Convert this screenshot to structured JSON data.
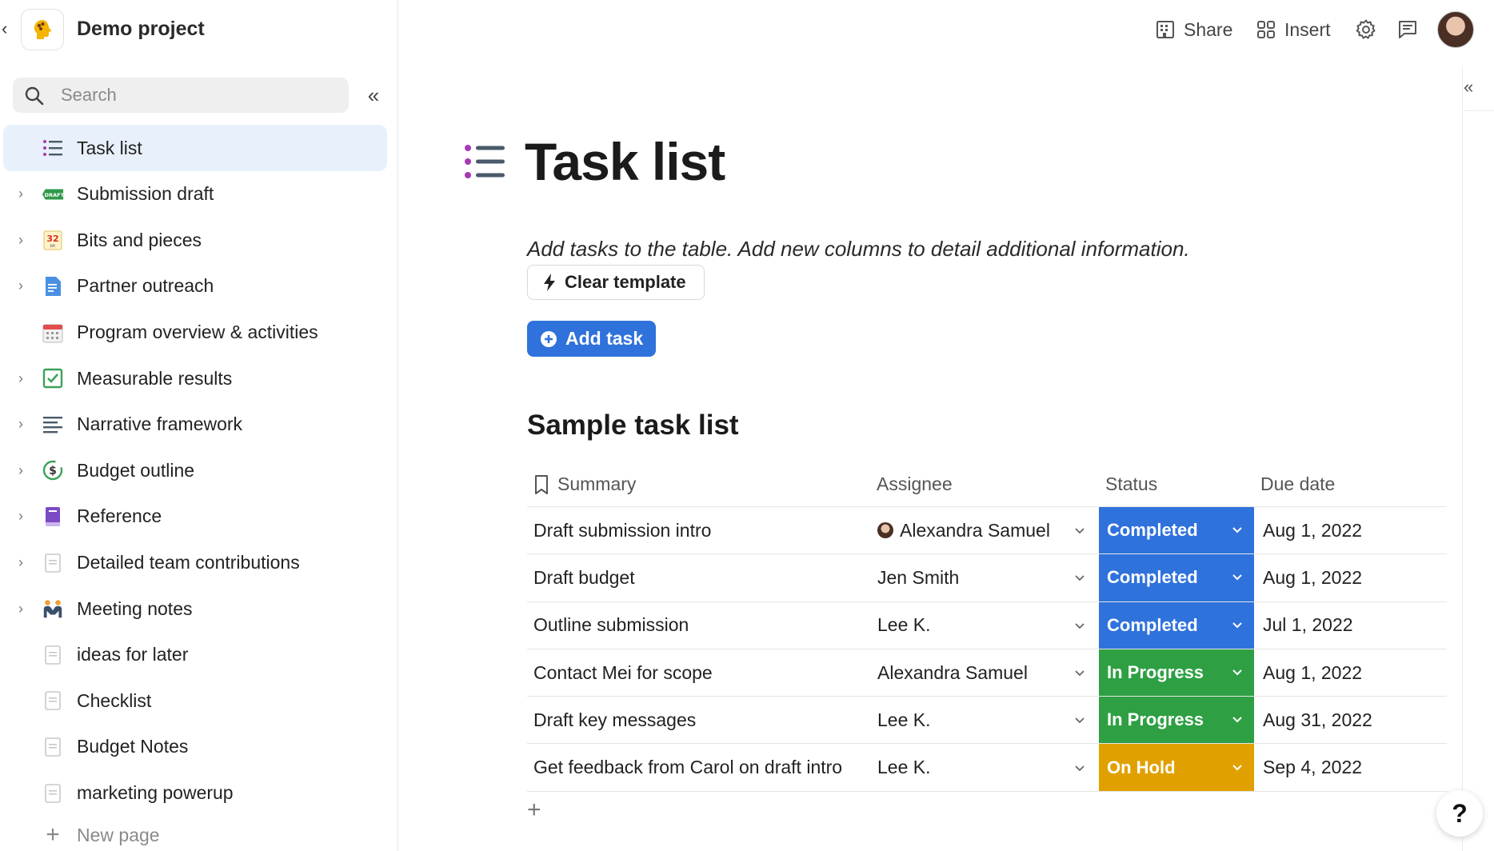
{
  "project": {
    "title": "Demo project"
  },
  "sidebar": {
    "search_placeholder": "Search",
    "items": [
      {
        "label": "Task list",
        "icon": "task-list-icon",
        "active": true,
        "has_chevron": false
      },
      {
        "label": "Submission draft",
        "icon": "draft-badge-icon",
        "active": false,
        "has_chevron": true
      },
      {
        "label": "Bits and pieces",
        "icon": "calendar-32-icon",
        "active": false,
        "has_chevron": true
      },
      {
        "label": "Partner outreach",
        "icon": "document-icon",
        "active": false,
        "has_chevron": true
      },
      {
        "label": "Program overview & activities",
        "icon": "calendar-grid-icon",
        "active": false,
        "has_chevron": false
      },
      {
        "label": "Measurable results",
        "icon": "checkbox-icon",
        "active": false,
        "has_chevron": true
      },
      {
        "label": "Narrative framework",
        "icon": "text-lines-icon",
        "active": false,
        "has_chevron": true
      },
      {
        "label": "Budget outline",
        "icon": "dollar-cycle-icon",
        "active": false,
        "has_chevron": true
      },
      {
        "label": "Reference",
        "icon": "book-icon",
        "active": false,
        "has_chevron": true
      },
      {
        "label": "Detailed team contributions",
        "icon": "page-icon",
        "active": false,
        "has_chevron": true
      },
      {
        "label": "Meeting notes",
        "icon": "people-icon",
        "active": false,
        "has_chevron": true
      },
      {
        "label": "ideas for later",
        "icon": "page-icon",
        "active": false,
        "has_chevron": false
      },
      {
        "label": "Checklist",
        "icon": "page-icon",
        "active": false,
        "has_chevron": false
      },
      {
        "label": "Budget Notes",
        "icon": "page-icon",
        "active": false,
        "has_chevron": false
      },
      {
        "label": "marketing powerup",
        "icon": "page-icon",
        "active": false,
        "has_chevron": false
      }
    ],
    "new_page_label": "New page"
  },
  "toolbar": {
    "share_label": "Share",
    "insert_label": "Insert"
  },
  "page": {
    "title": "Task list",
    "description": "Add tasks to the table. Add new columns to detail additional information.",
    "clear_template_label": "Clear template",
    "add_task_label": "Add task",
    "section_title": "Sample task list"
  },
  "table": {
    "columns": [
      "Summary",
      "Assignee",
      "Status",
      "Due date"
    ],
    "rows": [
      {
        "summary": "Draft submission intro",
        "assignee": "Alexandra Samuel",
        "avatar": true,
        "status": "Completed",
        "due": "Aug 1, 2022"
      },
      {
        "summary": "Draft budget",
        "assignee": "Jen Smith",
        "avatar": false,
        "status": "Completed",
        "due": "Aug 1, 2022"
      },
      {
        "summary": "Outline submission",
        "assignee": "Lee K.",
        "avatar": false,
        "status": "Completed",
        "due": "Jul 1, 2022"
      },
      {
        "summary": "Contact Mei for scope",
        "assignee": "Alexandra Samuel",
        "avatar": false,
        "status": "In Progress",
        "due": "Aug 1, 2022"
      },
      {
        "summary": "Draft key messages",
        "assignee": "Lee K.",
        "avatar": false,
        "status": "In Progress",
        "due": "Aug 31, 2022"
      },
      {
        "summary": "Get feedback from Carol on draft intro",
        "assignee": "Lee K.",
        "avatar": false,
        "status": "On Hold",
        "due": "Sep 4, 2022"
      }
    ]
  },
  "colors": {
    "accent": "#2f72dc",
    "completed": "#2f72dc",
    "in_progress": "#2ea043",
    "on_hold": "#e0a100",
    "active_nav_bg": "#e8f1fb"
  },
  "help_label": "?"
}
